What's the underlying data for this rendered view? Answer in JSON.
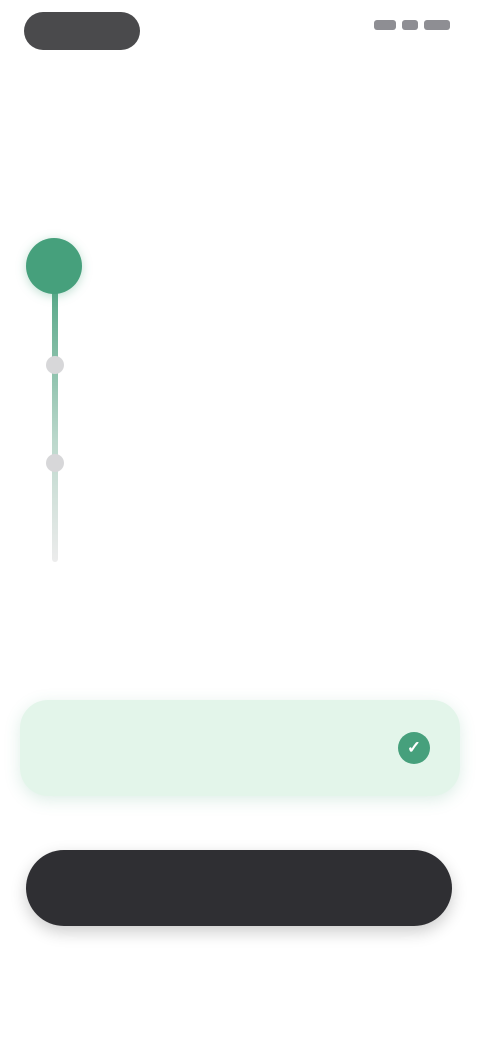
{
  "header": {
    "logo_text": "",
    "status_icons": [
      "signal-icon",
      "wifi-icon",
      "battery-icon"
    ]
  },
  "title": "",
  "steps": [
    {
      "title": "",
      "description": "",
      "state": "active"
    },
    {
      "title": "",
      "description": "",
      "state": "upcoming"
    },
    {
      "title": "",
      "description": "",
      "state": "upcoming"
    }
  ],
  "plan": {
    "name": "",
    "price": "",
    "selected": true,
    "check_icon": "✓"
  },
  "note": "",
  "cta": {
    "label": ""
  },
  "footnote": "",
  "colors": {
    "accent": "#46a07c",
    "card_bg": "#e3f5ea",
    "button_bg": "#2f2f33"
  }
}
